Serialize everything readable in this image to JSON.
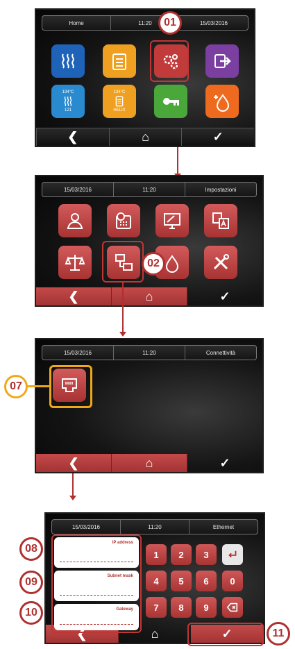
{
  "screen1": {
    "topbar": [
      "Home",
      "11:20",
      "15/03/2016"
    ],
    "tiles": [
      {
        "icon": "heat-waves-icon",
        "color": "#1e63b8"
      },
      {
        "icon": "clipboard-list-icon",
        "color": "#f0a020"
      },
      {
        "icon": "gears-icon",
        "color": "#c23b3b"
      },
      {
        "icon": "exit-icon",
        "color": "#7a3fa0"
      },
      {
        "icon": "program-134-icon",
        "color": "#2a8ad0",
        "text_top": "134°C",
        "text_bottom": "121"
      },
      {
        "icon": "program-helix-icon",
        "color": "#f0a020",
        "text_top": "134°C",
        "text_bottom": "HELIX"
      },
      {
        "icon": "key-icon",
        "color": "#4aa83a"
      },
      {
        "icon": "water-drop-icon",
        "color": "#ee6a1e"
      }
    ],
    "callout": "01"
  },
  "screen2": {
    "topbar": [
      "15/03/2016",
      "11:20",
      "Impostazioni"
    ],
    "callout": "02"
  },
  "screen3": {
    "topbar": [
      "15/03/2016",
      "11:20",
      "Connettività"
    ],
    "callout": "07"
  },
  "screen4": {
    "topbar": [
      "15/03/2016",
      "11:20",
      "Ethernet"
    ],
    "fields": [
      {
        "label": "IP address",
        "callout": "08"
      },
      {
        "label": "Subnet mask",
        "callout": "09"
      },
      {
        "label": "Gateway",
        "callout": "10"
      }
    ],
    "keys": [
      "1",
      "2",
      "3",
      "4",
      "5",
      "6",
      "0",
      "7",
      "8",
      "9"
    ],
    "callout": "11"
  },
  "nav": {
    "back": "❮",
    "home": "⌂",
    "confirm": "✓"
  }
}
